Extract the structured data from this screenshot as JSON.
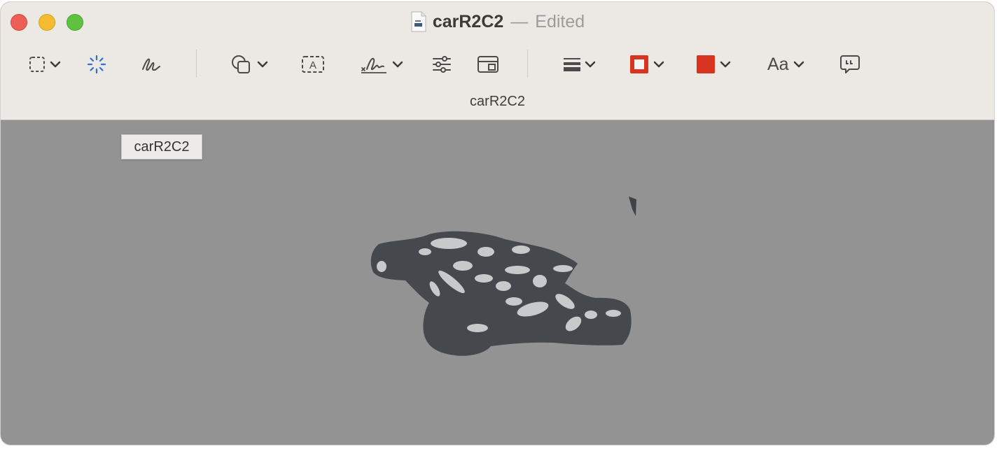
{
  "window": {
    "title": "carR2C2",
    "title_separator": "—",
    "status": "Edited"
  },
  "toolbar": {
    "items": [
      {
        "name": "selection-tool",
        "icon": "dashed-rect-icon"
      },
      {
        "name": "instant-alpha",
        "icon": "magic-wand-icon"
      },
      {
        "name": "sketch",
        "icon": "sketch-icon"
      },
      {
        "name": "shapes",
        "icon": "shapes-icon"
      },
      {
        "name": "text",
        "icon": "text-box-icon"
      },
      {
        "name": "sign",
        "icon": "signature-icon"
      },
      {
        "name": "adjust-color",
        "icon": "sliders-icon"
      },
      {
        "name": "adjust-size",
        "icon": "resize-icon"
      },
      {
        "name": "shape-style",
        "icon": "lines-icon"
      },
      {
        "name": "border-color",
        "icon": "border-color-icon",
        "color": "#d9341f"
      },
      {
        "name": "fill-color",
        "icon": "fill-color-icon",
        "color": "#d9341f"
      },
      {
        "name": "text-style",
        "icon": "text-style-icon",
        "label": "Aa"
      },
      {
        "name": "annotate",
        "icon": "speech-bubble-icon"
      }
    ]
  },
  "document_subtitle": "carR2C2",
  "tooltip": "carR2C2",
  "colors": {
    "titlebar": "#ece8e3",
    "canvas": "#939393",
    "accent_blue": "#2f6fd6",
    "accent_red": "#d9341f"
  }
}
